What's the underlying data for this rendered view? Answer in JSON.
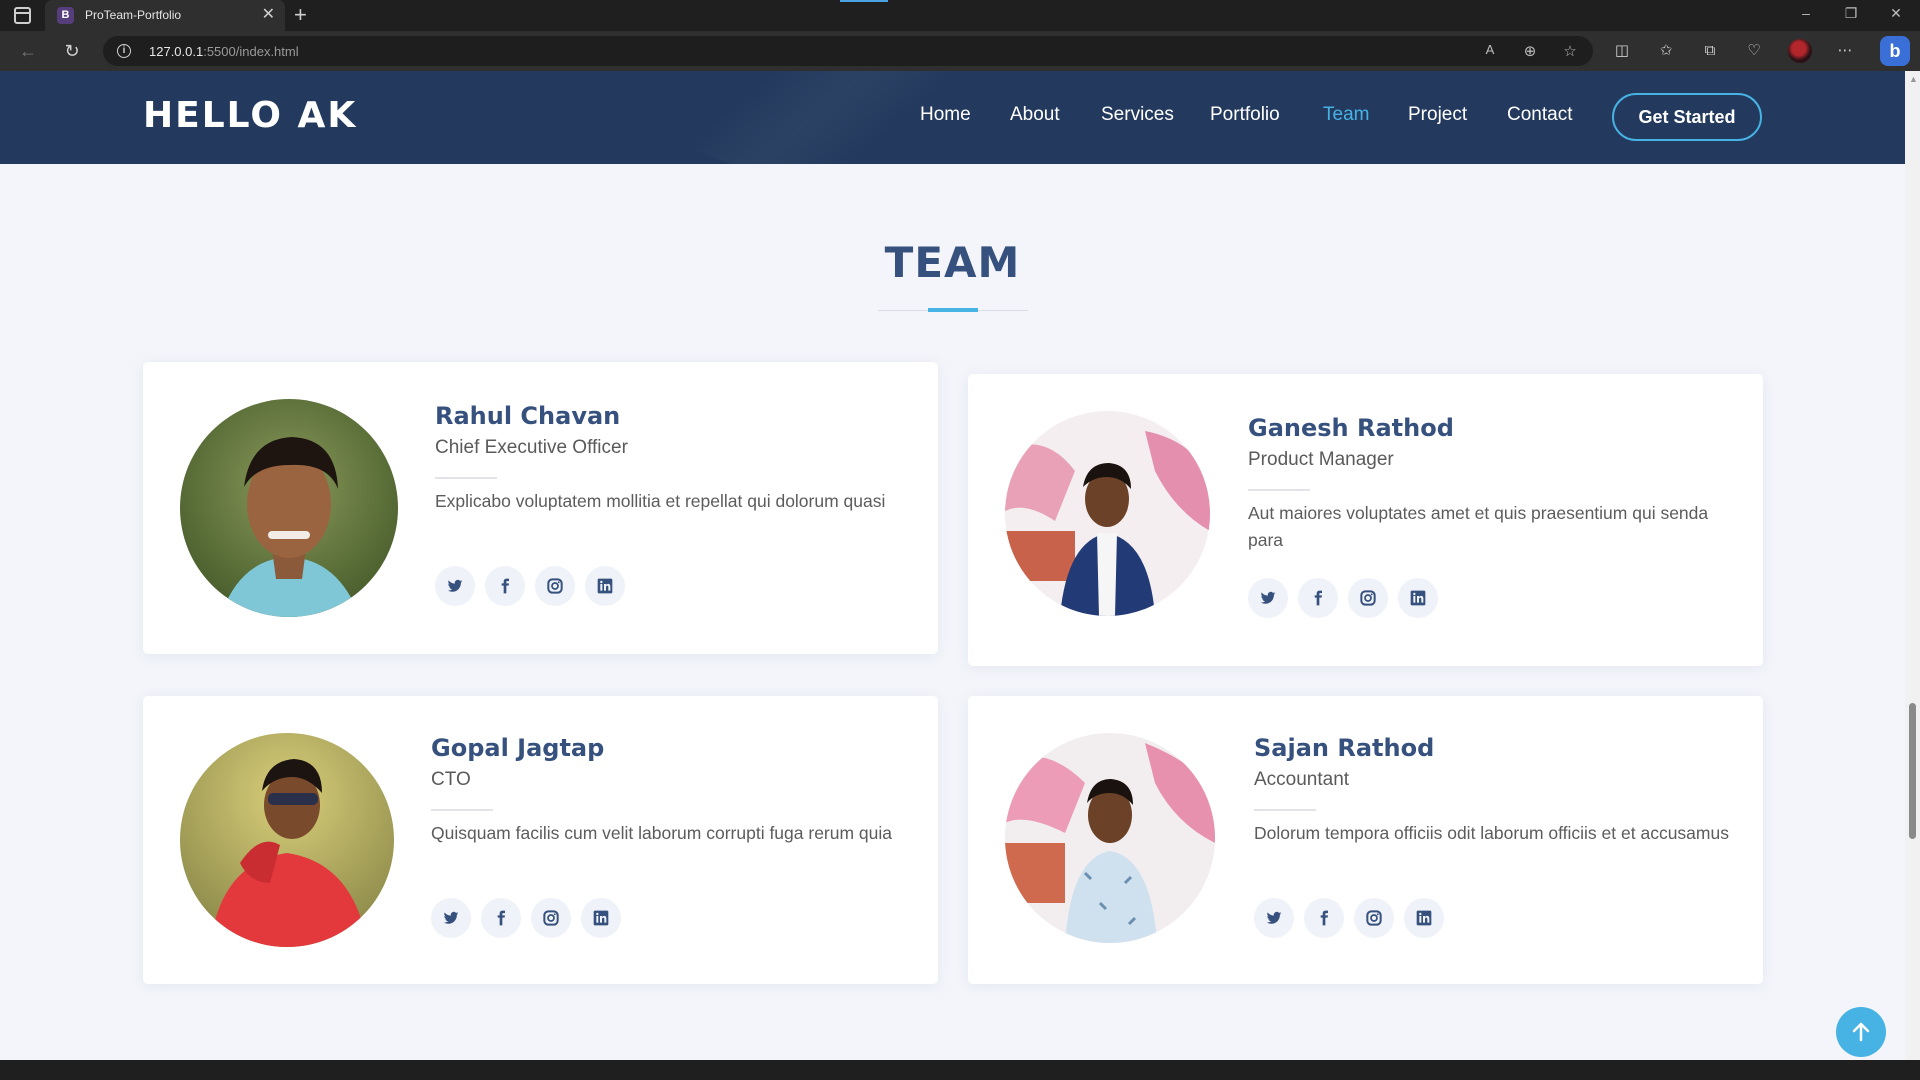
{
  "browser": {
    "tab_title": "ProTeam-Portfolio",
    "tab_favicon_letter": "B",
    "url_host": "127.0.0.1",
    "url_rest": ":5500/index.html"
  },
  "header": {
    "logo": "HELLO AK",
    "nav": [
      {
        "label": "Home"
      },
      {
        "label": "About"
      },
      {
        "label": "Services"
      },
      {
        "label": "Portfolio"
      },
      {
        "label": "Team",
        "active": true
      },
      {
        "label": "Project"
      },
      {
        "label": "Contact"
      }
    ],
    "cta": "Get Started"
  },
  "team": {
    "title": "TEAM",
    "members": [
      {
        "name": "Rahul Chavan",
        "role": "Chief Executive Officer",
        "desc": "Explicabo voluptatem mollitia et repellat qui dolorum quasi"
      },
      {
        "name": "Ganesh Rathod",
        "role": "Product Manager",
        "desc": "Aut maiores voluptates amet et quis praesentium qui senda para"
      },
      {
        "name": "Gopal Jagtap",
        "role": "CTO",
        "desc": "Quisquam facilis cum velit laborum corrupti fuga rerum quia"
      },
      {
        "name": "Sajan Rathod",
        "role": "Accountant",
        "desc": "Dolorum tempora officiis odit laborum officiis et et accusamus"
      }
    ],
    "social_icons": [
      "twitter-icon",
      "facebook-icon",
      "instagram-icon",
      "linkedin-icon"
    ]
  },
  "colors": {
    "header_bg": "#233a5e",
    "accent": "#47b2e4",
    "heading": "#37517e",
    "page_bg": "#f3f5fa"
  }
}
